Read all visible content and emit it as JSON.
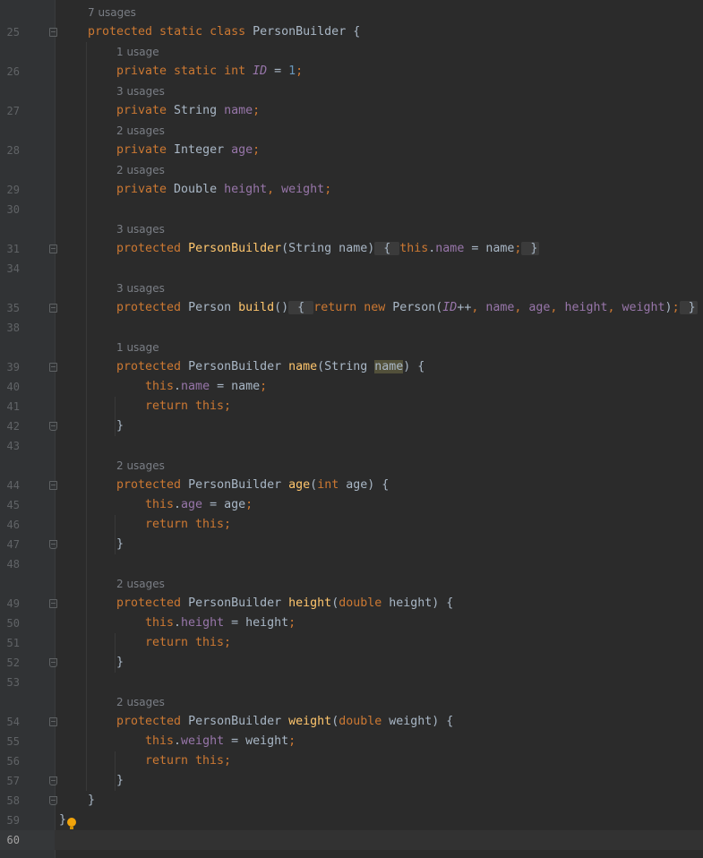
{
  "editor": {
    "language": "java",
    "caret_line": "60",
    "lines": [
      {
        "num": "",
        "hint": "7 usages"
      },
      {
        "num": "25",
        "fold": "start",
        "code": [
          [
            "kw",
            "protected static class "
          ],
          [
            "",
            "PersonBuilder {"
          ]
        ]
      },
      {
        "num": "",
        "hint": "1 usage"
      },
      {
        "num": "26",
        "code": [
          [
            "kw",
            "private static int "
          ],
          [
            "st",
            "ID"
          ],
          [
            "",
            " = "
          ],
          [
            "nm",
            "1"
          ],
          [
            "kw",
            ";"
          ]
        ]
      },
      {
        "num": "",
        "hint": "3 usages"
      },
      {
        "num": "27",
        "code": [
          [
            "kw",
            "private "
          ],
          [
            "",
            "String "
          ],
          [
            "fld",
            "name"
          ],
          [
            "kw",
            ";"
          ]
        ]
      },
      {
        "num": "",
        "hint": "2 usages"
      },
      {
        "num": "28",
        "code": [
          [
            "kw",
            "private "
          ],
          [
            "",
            "Integer "
          ],
          [
            "fld",
            "age"
          ],
          [
            "kw",
            ";"
          ]
        ]
      },
      {
        "num": "",
        "hint": "2 usages"
      },
      {
        "num": "29",
        "code": [
          [
            "kw",
            "private "
          ],
          [
            "",
            "Double "
          ],
          [
            "fld",
            "height"
          ],
          [
            "kw",
            ", "
          ],
          [
            "fld",
            "weight"
          ],
          [
            "kw",
            ";"
          ]
        ]
      },
      {
        "num": "30",
        "code": []
      },
      {
        "num": "",
        "hint": "3 usages"
      },
      {
        "num": "31",
        "fold": "collapsed",
        "code": [
          [
            "kw",
            "protected "
          ],
          [
            "fn",
            "PersonBuilder"
          ],
          [
            "",
            "(String name)"
          ],
          [
            "box",
            " { "
          ],
          [
            "kw",
            "this"
          ],
          [
            "",
            "."
          ],
          [
            "fld",
            "name"
          ],
          [
            "",
            " = name"
          ],
          [
            "kw",
            ";"
          ],
          [
            "box",
            " }"
          ]
        ]
      },
      {
        "num": "34",
        "code": []
      },
      {
        "num": "",
        "hint": "3 usages"
      },
      {
        "num": "35",
        "fold": "collapsed",
        "code": [
          [
            "kw",
            "protected "
          ],
          [
            "",
            "Person "
          ],
          [
            "fn",
            "build"
          ],
          [
            "",
            "()"
          ],
          [
            "box",
            " { "
          ],
          [
            "kw",
            "return new "
          ],
          [
            "",
            "Person("
          ],
          [
            "st",
            "ID"
          ],
          [
            "",
            "++"
          ],
          [
            "kw",
            ", "
          ],
          [
            "fld",
            "name"
          ],
          [
            "kw",
            ", "
          ],
          [
            "fld",
            "age"
          ],
          [
            "kw",
            ", "
          ],
          [
            "fld",
            "height"
          ],
          [
            "kw",
            ", "
          ],
          [
            "fld",
            "weight"
          ],
          [
            "",
            ")"
          ],
          [
            "kw",
            ";"
          ],
          [
            "box",
            " }"
          ]
        ]
      },
      {
        "num": "38",
        "code": []
      },
      {
        "num": "",
        "hint": "1 usage"
      },
      {
        "num": "39",
        "fold": "start",
        "code": [
          [
            "kw",
            "protected "
          ],
          [
            "",
            "PersonBuilder "
          ],
          [
            "fn",
            "name"
          ],
          [
            "",
            "(String "
          ],
          [
            "hl",
            "name"
          ],
          [
            "",
            ") {"
          ]
        ]
      },
      {
        "num": "40",
        "code": [
          [
            "kw",
            "this"
          ],
          [
            "",
            "."
          ],
          [
            "fld",
            "name"
          ],
          [
            "",
            " = name"
          ],
          [
            "kw",
            ";"
          ]
        ]
      },
      {
        "num": "41",
        "code": [
          [
            "kw",
            "return this;"
          ]
        ]
      },
      {
        "num": "42",
        "fold": "end",
        "code": [
          [
            "",
            "}"
          ]
        ]
      },
      {
        "num": "43",
        "code": []
      },
      {
        "num": "",
        "hint": "2 usages"
      },
      {
        "num": "44",
        "fold": "start",
        "code": [
          [
            "kw",
            "protected "
          ],
          [
            "",
            "PersonBuilder "
          ],
          [
            "fn",
            "age"
          ],
          [
            "",
            "("
          ],
          [
            "kw",
            "int "
          ],
          [
            "",
            "age) {"
          ]
        ]
      },
      {
        "num": "45",
        "code": [
          [
            "kw",
            "this"
          ],
          [
            "",
            "."
          ],
          [
            "fld",
            "age"
          ],
          [
            "",
            " = age"
          ],
          [
            "kw",
            ";"
          ]
        ]
      },
      {
        "num": "46",
        "code": [
          [
            "kw",
            "return this;"
          ]
        ]
      },
      {
        "num": "47",
        "fold": "end",
        "code": [
          [
            "",
            "}"
          ]
        ]
      },
      {
        "num": "48",
        "code": []
      },
      {
        "num": "",
        "hint": "2 usages"
      },
      {
        "num": "49",
        "fold": "start",
        "code": [
          [
            "kw",
            "protected "
          ],
          [
            "",
            "PersonBuilder "
          ],
          [
            "fn",
            "height"
          ],
          [
            "",
            "("
          ],
          [
            "kw",
            "double "
          ],
          [
            "",
            "height) {"
          ]
        ]
      },
      {
        "num": "50",
        "code": [
          [
            "kw",
            "this"
          ],
          [
            "",
            "."
          ],
          [
            "fld",
            "height"
          ],
          [
            "",
            " = height"
          ],
          [
            "kw",
            ";"
          ]
        ]
      },
      {
        "num": "51",
        "code": [
          [
            "kw",
            "return this;"
          ]
        ]
      },
      {
        "num": "52",
        "fold": "end",
        "code": [
          [
            "",
            "}"
          ]
        ]
      },
      {
        "num": "53",
        "code": []
      },
      {
        "num": "",
        "hint": "2 usages"
      },
      {
        "num": "54",
        "fold": "start",
        "code": [
          [
            "kw",
            "protected "
          ],
          [
            "",
            "PersonBuilder "
          ],
          [
            "fn",
            "weight"
          ],
          [
            "",
            "("
          ],
          [
            "kw",
            "double "
          ],
          [
            "",
            "weight) {"
          ]
        ]
      },
      {
        "num": "55",
        "code": [
          [
            "kw",
            "this"
          ],
          [
            "",
            "."
          ],
          [
            "fld",
            "weight"
          ],
          [
            "",
            " = weight"
          ],
          [
            "kw",
            ";"
          ]
        ]
      },
      {
        "num": "56",
        "code": [
          [
            "kw",
            "return this;"
          ]
        ]
      },
      {
        "num": "57",
        "fold": "end",
        "code": [
          [
            "",
            "}"
          ]
        ]
      },
      {
        "num": "58",
        "fold": "end",
        "code": [
          [
            "",
            "}"
          ]
        ]
      },
      {
        "num": "59",
        "code": [
          [
            "",
            "}"
          ]
        ],
        "bulb": true
      },
      {
        "num": "60",
        "code": []
      }
    ]
  },
  "icons": {
    "intention": "lightbulb-icon",
    "fold": "fold-marker-icon"
  }
}
